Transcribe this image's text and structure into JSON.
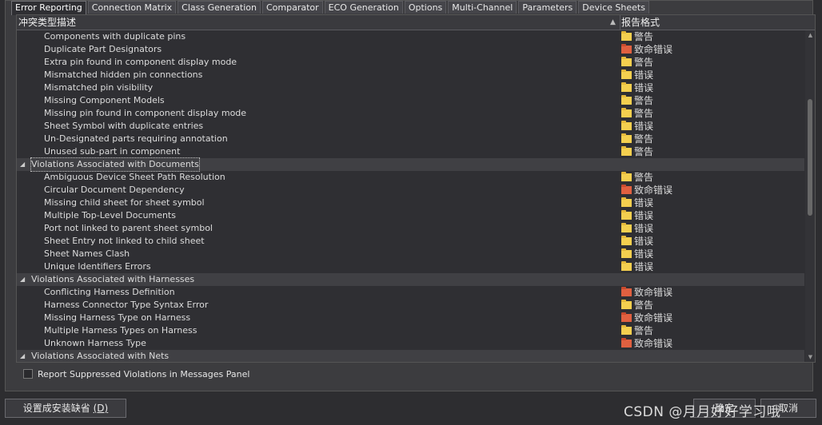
{
  "tabs": [
    "Error Reporting",
    "Connection Matrix",
    "Class Generation",
    "Comparator",
    "ECO Generation",
    "Options",
    "Multi-Channel",
    "Parameters",
    "Device Sheets"
  ],
  "columns": {
    "type": "冲突类型描述",
    "format": "报告格式"
  },
  "rows": [
    {
      "kind": "item",
      "label": "Components with duplicate pins",
      "sev": "警告",
      "color": "yellow"
    },
    {
      "kind": "item",
      "label": "Duplicate Part Designators",
      "sev": "致命错误",
      "color": "red"
    },
    {
      "kind": "item",
      "label": "Extra pin found in component display mode",
      "sev": "警告",
      "color": "yellow"
    },
    {
      "kind": "item",
      "label": "Mismatched hidden pin connections",
      "sev": "错误",
      "color": "yellow"
    },
    {
      "kind": "item",
      "label": "Mismatched pin visibility",
      "sev": "错误",
      "color": "yellow"
    },
    {
      "kind": "item",
      "label": "Missing Component Models",
      "sev": "警告",
      "color": "yellow"
    },
    {
      "kind": "item",
      "label": "Missing pin found in component display mode",
      "sev": "警告",
      "color": "yellow"
    },
    {
      "kind": "item",
      "label": "Sheet Symbol with duplicate entries",
      "sev": "错误",
      "color": "yellow"
    },
    {
      "kind": "item",
      "label": "Un-Designated parts requiring annotation",
      "sev": "警告",
      "color": "yellow"
    },
    {
      "kind": "item",
      "label": "Unused sub-part in component",
      "sev": "警告",
      "color": "yellow"
    },
    {
      "kind": "group",
      "label": "Violations Associated with Documents",
      "selected": true
    },
    {
      "kind": "item",
      "label": "Ambiguous Device Sheet Path Resolution",
      "sev": "警告",
      "color": "yellow"
    },
    {
      "kind": "item",
      "label": "Circular Document Dependency",
      "sev": "致命错误",
      "color": "red"
    },
    {
      "kind": "item",
      "label": "Missing child sheet for sheet symbol",
      "sev": "错误",
      "color": "yellow"
    },
    {
      "kind": "item",
      "label": "Multiple Top-Level Documents",
      "sev": "错误",
      "color": "yellow"
    },
    {
      "kind": "item",
      "label": "Port not linked to parent sheet symbol",
      "sev": "错误",
      "color": "yellow"
    },
    {
      "kind": "item",
      "label": "Sheet Entry not linked to child sheet",
      "sev": "错误",
      "color": "yellow"
    },
    {
      "kind": "item",
      "label": "Sheet Names Clash",
      "sev": "错误",
      "color": "yellow"
    },
    {
      "kind": "item",
      "label": "Unique Identifiers Errors",
      "sev": "错误",
      "color": "yellow"
    },
    {
      "kind": "group",
      "label": "Violations Associated with Harnesses"
    },
    {
      "kind": "item",
      "label": "Conflicting Harness Definition",
      "sev": "致命错误",
      "color": "red"
    },
    {
      "kind": "item",
      "label": "Harness Connector Type Syntax Error",
      "sev": "警告",
      "color": "yellow"
    },
    {
      "kind": "item",
      "label": "Missing Harness Type on Harness",
      "sev": "致命错误",
      "color": "red"
    },
    {
      "kind": "item",
      "label": "Multiple Harness Types on Harness",
      "sev": "警告",
      "color": "yellow"
    },
    {
      "kind": "item",
      "label": "Unknown Harness Type",
      "sev": "致命错误",
      "color": "red"
    },
    {
      "kind": "group",
      "label": "Violations Associated with Nets"
    }
  ],
  "option": {
    "label": "Report Suppressed Violations in Messages Panel",
    "checked": false
  },
  "buttons": {
    "defaults": "设置成安装缺省",
    "defaults_key": "(D)",
    "ok": "确定",
    "cancel": "取消"
  },
  "watermark": "CSDN @月月好好学习哦"
}
